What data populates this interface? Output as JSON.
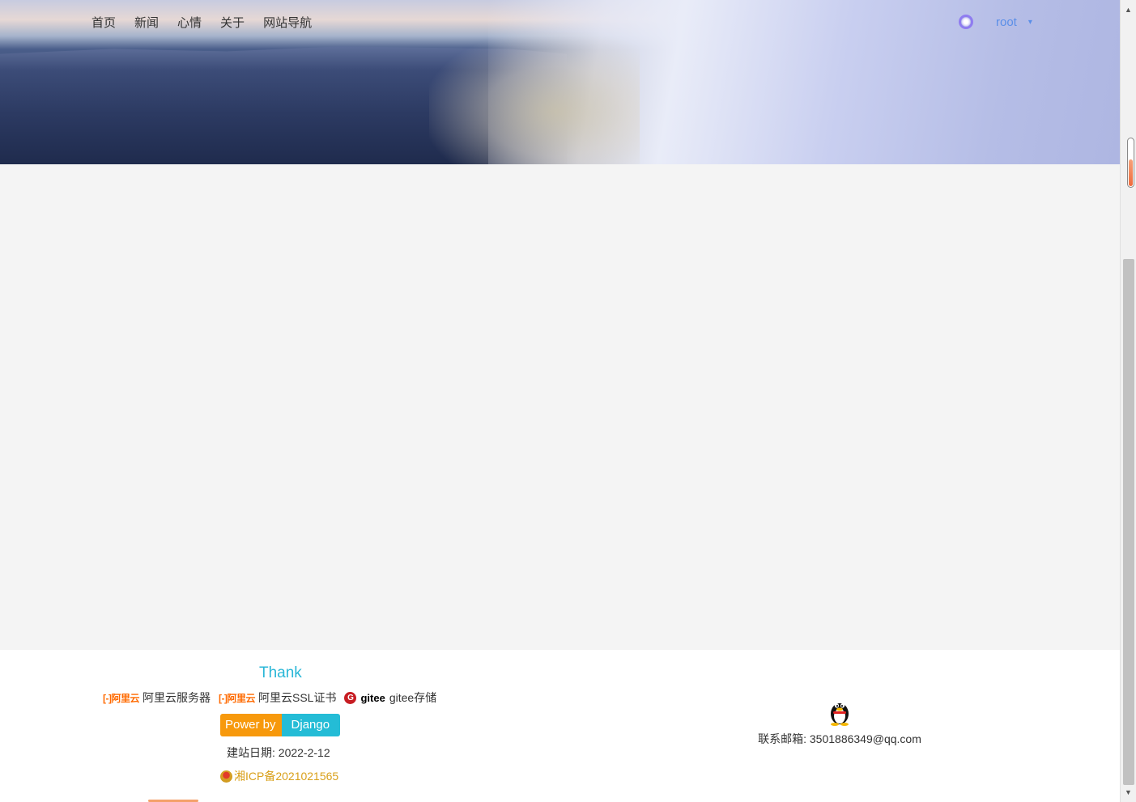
{
  "nav": {
    "items": [
      {
        "label": "首页"
      },
      {
        "label": "新闻"
      },
      {
        "label": "心情"
      },
      {
        "label": "关于"
      },
      {
        "label": "网站导航"
      }
    ]
  },
  "user": {
    "name": "root",
    "avatar_icon": "avatar-ring-icon",
    "caret_icon": "chevron-down-icon"
  },
  "footer": {
    "thank_title": "Thank",
    "sponsors": [
      {
        "logo_text": "[-]阿里云",
        "label": "阿里云服务器"
      },
      {
        "logo_text": "[-]阿里云",
        "label": "阿里云SSL证书"
      },
      {
        "logo_text": "gitee",
        "label": "gitee存储"
      }
    ],
    "power_by": {
      "left": "Power by",
      "right": "Django"
    },
    "built_date": "建站日期: 2022-2-12",
    "icp": "湘ICP备2021021565",
    "contact_email": "联系邮箱: 3501886349@qq.com"
  },
  "colors": {
    "accent": "#2ab7d7",
    "power_left": "#f7990c",
    "power_right": "#24bcd6",
    "icp": "#d9a01a",
    "link_user": "#5b8fe8",
    "aliyun": "#ff6a00",
    "gitee": "#c71d23"
  },
  "reading_progress": 0.55
}
